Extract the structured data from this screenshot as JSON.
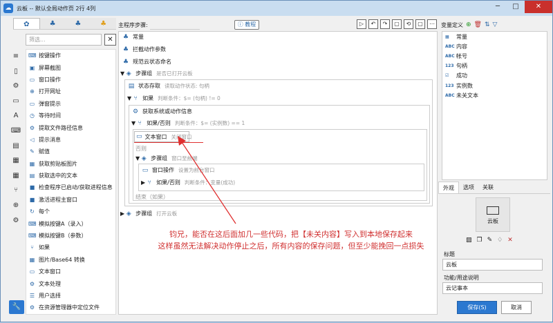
{
  "window": {
    "title": "云板 -- 默认全局动作页 2行 4列",
    "minimize": "─",
    "maximize": "□",
    "close": "✕"
  },
  "left_tabs": [
    {
      "icon": "gear-cluster-icon",
      "glyph": "✿"
    },
    {
      "icon": "cluster-icon",
      "glyph": "♣"
    },
    {
      "icon": "cluster-icon",
      "glyph": "♣"
    },
    {
      "icon": "cluster-icon",
      "glyph": "♣"
    }
  ],
  "search": {
    "placeholder": "筛选...",
    "clear": "✕"
  },
  "side_icons": [
    "≡",
    "▯",
    "⚙",
    "▭",
    "A",
    "⌨",
    "▤",
    "▦",
    "▦",
    "⑂",
    "⊕",
    "⚙"
  ],
  "components": [
    {
      "label": "按键操作",
      "glyph": "⌨"
    },
    {
      "label": "屏幕截图",
      "glyph": "▣"
    },
    {
      "label": "窗口操作",
      "glyph": "▭"
    },
    {
      "label": "打开网址",
      "glyph": "⊕"
    },
    {
      "label": "弹窗提示",
      "glyph": "▭"
    },
    {
      "label": "等待时间",
      "glyph": "◷"
    },
    {
      "label": "提取文件路径信息",
      "glyph": "⚙"
    },
    {
      "label": "提示消息",
      "glyph": "◁"
    },
    {
      "label": "赋值",
      "glyph": "✎"
    },
    {
      "label": "获取剪贴板图片",
      "glyph": "▦"
    },
    {
      "label": "获取选中的文本",
      "glyph": "▤"
    },
    {
      "label": "检查程序已启动/获取进程信息",
      "glyph": "■"
    },
    {
      "label": "激活进程主窗口",
      "glyph": "■"
    },
    {
      "label": "每个",
      "glyph": "↻"
    },
    {
      "label": "模拟按键A（录入）",
      "glyph": "⌨"
    },
    {
      "label": "模拟按键B（参数）",
      "glyph": "⌨"
    },
    {
      "label": "如果",
      "glyph": "⑂"
    },
    {
      "label": "图片/Base64 转换",
      "glyph": "▦"
    },
    {
      "label": "文本窗口",
      "glyph": "▭"
    },
    {
      "label": "文本处理",
      "glyph": "⚙"
    },
    {
      "label": "用户选择",
      "glyph": "☰"
    },
    {
      "label": "在资源管理器中定位文件",
      "glyph": "⚙"
    }
  ],
  "flow": {
    "label": "主程序步骤:",
    "help": "ⓘ 教程",
    "toolbar": [
      "▷",
      "↶",
      "↷",
      "▢",
      "⟲",
      "▢",
      "⋯"
    ],
    "steps": {
      "s1": "常量",
      "s2": "拦截动作参数",
      "s3": "规范云状态命名",
      "s4": "步骤组",
      "s4h": "是否已打开云板",
      "s5": "状态存取",
      "s5h": "读取动作状态: 句柄",
      "s6": "如果",
      "s6h": "判断条件：$= (句柄) != 0",
      "s7": "获取系统或动作信息",
      "s8": "如果/否则",
      "s8h": "判断条件：$= (实例数) == 1",
      "s9": "文本窗口",
      "s9h": "关闭窗口",
      "s10": "否则",
      "s11": "步骤组",
      "s11h": "窗口至前端",
      "s12": "窗口操作",
      "s12h": "设置为前台窗口",
      "s13": "如果/否则",
      "s13h": "判断条件：变量(成功)",
      "s14": "结束（如果）",
      "s15": "步骤组",
      "s15h": "打开云板"
    }
  },
  "annotation": {
    "line1": "钧兄，能否在这后面加几一些代码，把【未关内容】写入到本地保存起来",
    "line2": "这样虽然无法解决动作停止之后，所有内容的保存问题，但至少能挽回一点损失"
  },
  "variables": {
    "title": "变量定义",
    "items": [
      {
        "type": "▦",
        "name": "常量"
      },
      {
        "type": "ABC",
        "name": "内容"
      },
      {
        "type": "ABC",
        "name": "帐号"
      },
      {
        "type": "123",
        "name": "句柄"
      },
      {
        "type": "☑",
        "name": "成功"
      },
      {
        "type": "123",
        "name": "实例数"
      },
      {
        "type": "ABC",
        "name": "未关文本"
      }
    ]
  },
  "props": {
    "tabs": [
      "外观",
      "选项",
      "关联"
    ],
    "thumb_label": "云板",
    "title_label": "标题",
    "title_value": "云板",
    "desc_label": "功能/用途说明",
    "desc_value": "云记事本"
  },
  "buttons": {
    "save": "保存(S)",
    "cancel": "取消"
  },
  "colors": {
    "accent": "#2b78d0",
    "annotation": "#d03030"
  }
}
